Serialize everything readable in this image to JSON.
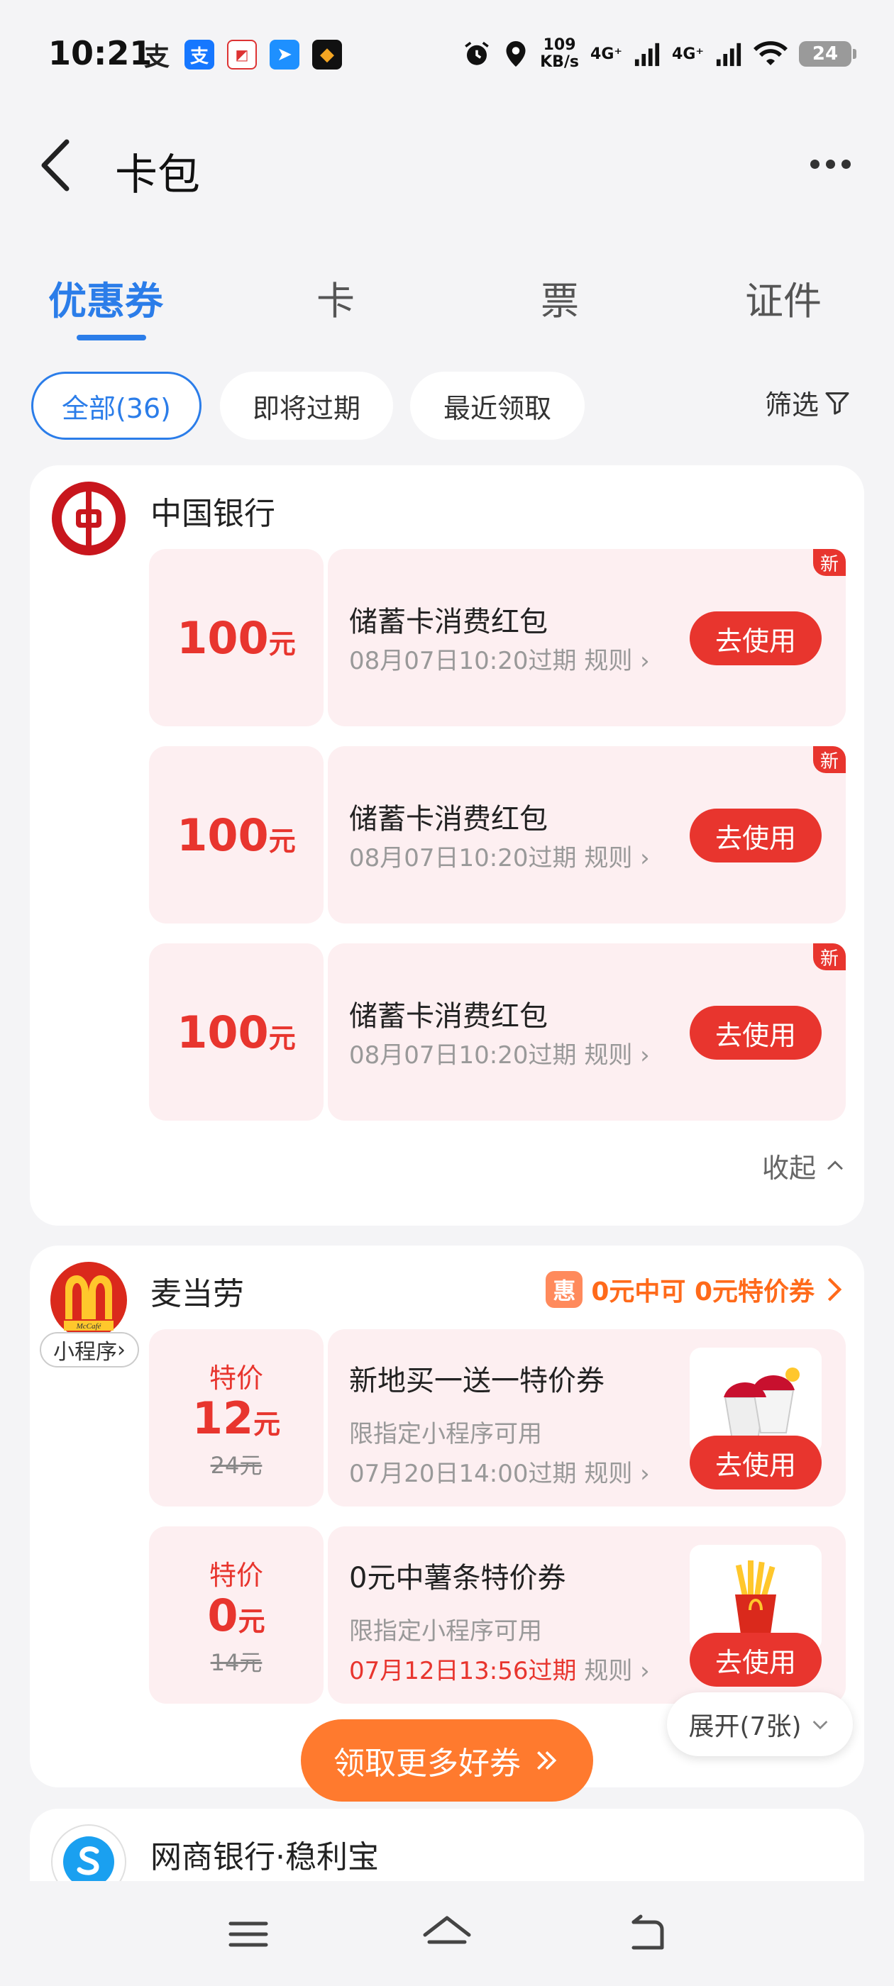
{
  "status_bar": {
    "time": "10:21",
    "app_icons": [
      "alipay-small-icon",
      "alipay-icon",
      "app-icon",
      "bird-icon",
      "shield-app-icon"
    ],
    "speed_value": "109",
    "speed_unit": "KB/s",
    "net1": "4G⁺",
    "net2": "4G⁺",
    "battery": "24"
  },
  "header": {
    "title": "卡包"
  },
  "tabs": [
    {
      "label": "优惠券",
      "active": true
    },
    {
      "label": "卡"
    },
    {
      "label": "票"
    },
    {
      "label": "证件"
    }
  ],
  "filters": {
    "chips": [
      {
        "label": "全部(36)",
        "active": true
      },
      {
        "label": "即将过期"
      },
      {
        "label": "最近领取"
      }
    ],
    "filter_label": "筛选"
  },
  "boc": {
    "name": "中国银行",
    "collapse_label": "收起",
    "coupons": [
      {
        "amount": "100",
        "unit": "元",
        "title": "储蓄卡消费红包",
        "expiry": "08月07日10:20过期",
        "rules": "规则",
        "action": "去使用",
        "badge": "新"
      },
      {
        "amount": "100",
        "unit": "元",
        "title": "储蓄卡消费红包",
        "expiry": "08月07日10:20过期",
        "rules": "规则",
        "action": "去使用",
        "badge": "新"
      },
      {
        "amount": "100",
        "unit": "元",
        "title": "储蓄卡消费红包",
        "expiry": "08月07日10:20过期",
        "rules": "规则",
        "action": "去使用",
        "badge": "新"
      }
    ]
  },
  "mcd": {
    "name": "麦当劳",
    "mini_program": "小程序",
    "promo_badge": "惠",
    "promo_text": "0元中可 0元特价券",
    "coupons": [
      {
        "price_label": "特价",
        "price": "12",
        "unit": "元",
        "original": "24元",
        "title": "新地买一送一特价券",
        "scope": "限指定小程序可用",
        "expiry": "07月20日14:00过期",
        "rules": "规则",
        "action": "去使用"
      },
      {
        "price_label": "特价",
        "price": "0",
        "unit": "元",
        "original": "14元",
        "title": "0元中薯条特价券",
        "scope": "限指定小程序可用",
        "expiry": "07月12日13:56过期",
        "rules": "规则",
        "action": "去使用"
      }
    ],
    "expand_label": "展开(7张)",
    "more_coupons": "领取更多好券"
  },
  "mybank": {
    "name": "网商银行·稳利宝"
  },
  "colors": {
    "accent": "#2b7de9",
    "coupon_red": "#e8352e",
    "coupon_bg": "#fdeff1",
    "promo_orange": "#ff7a2e"
  }
}
